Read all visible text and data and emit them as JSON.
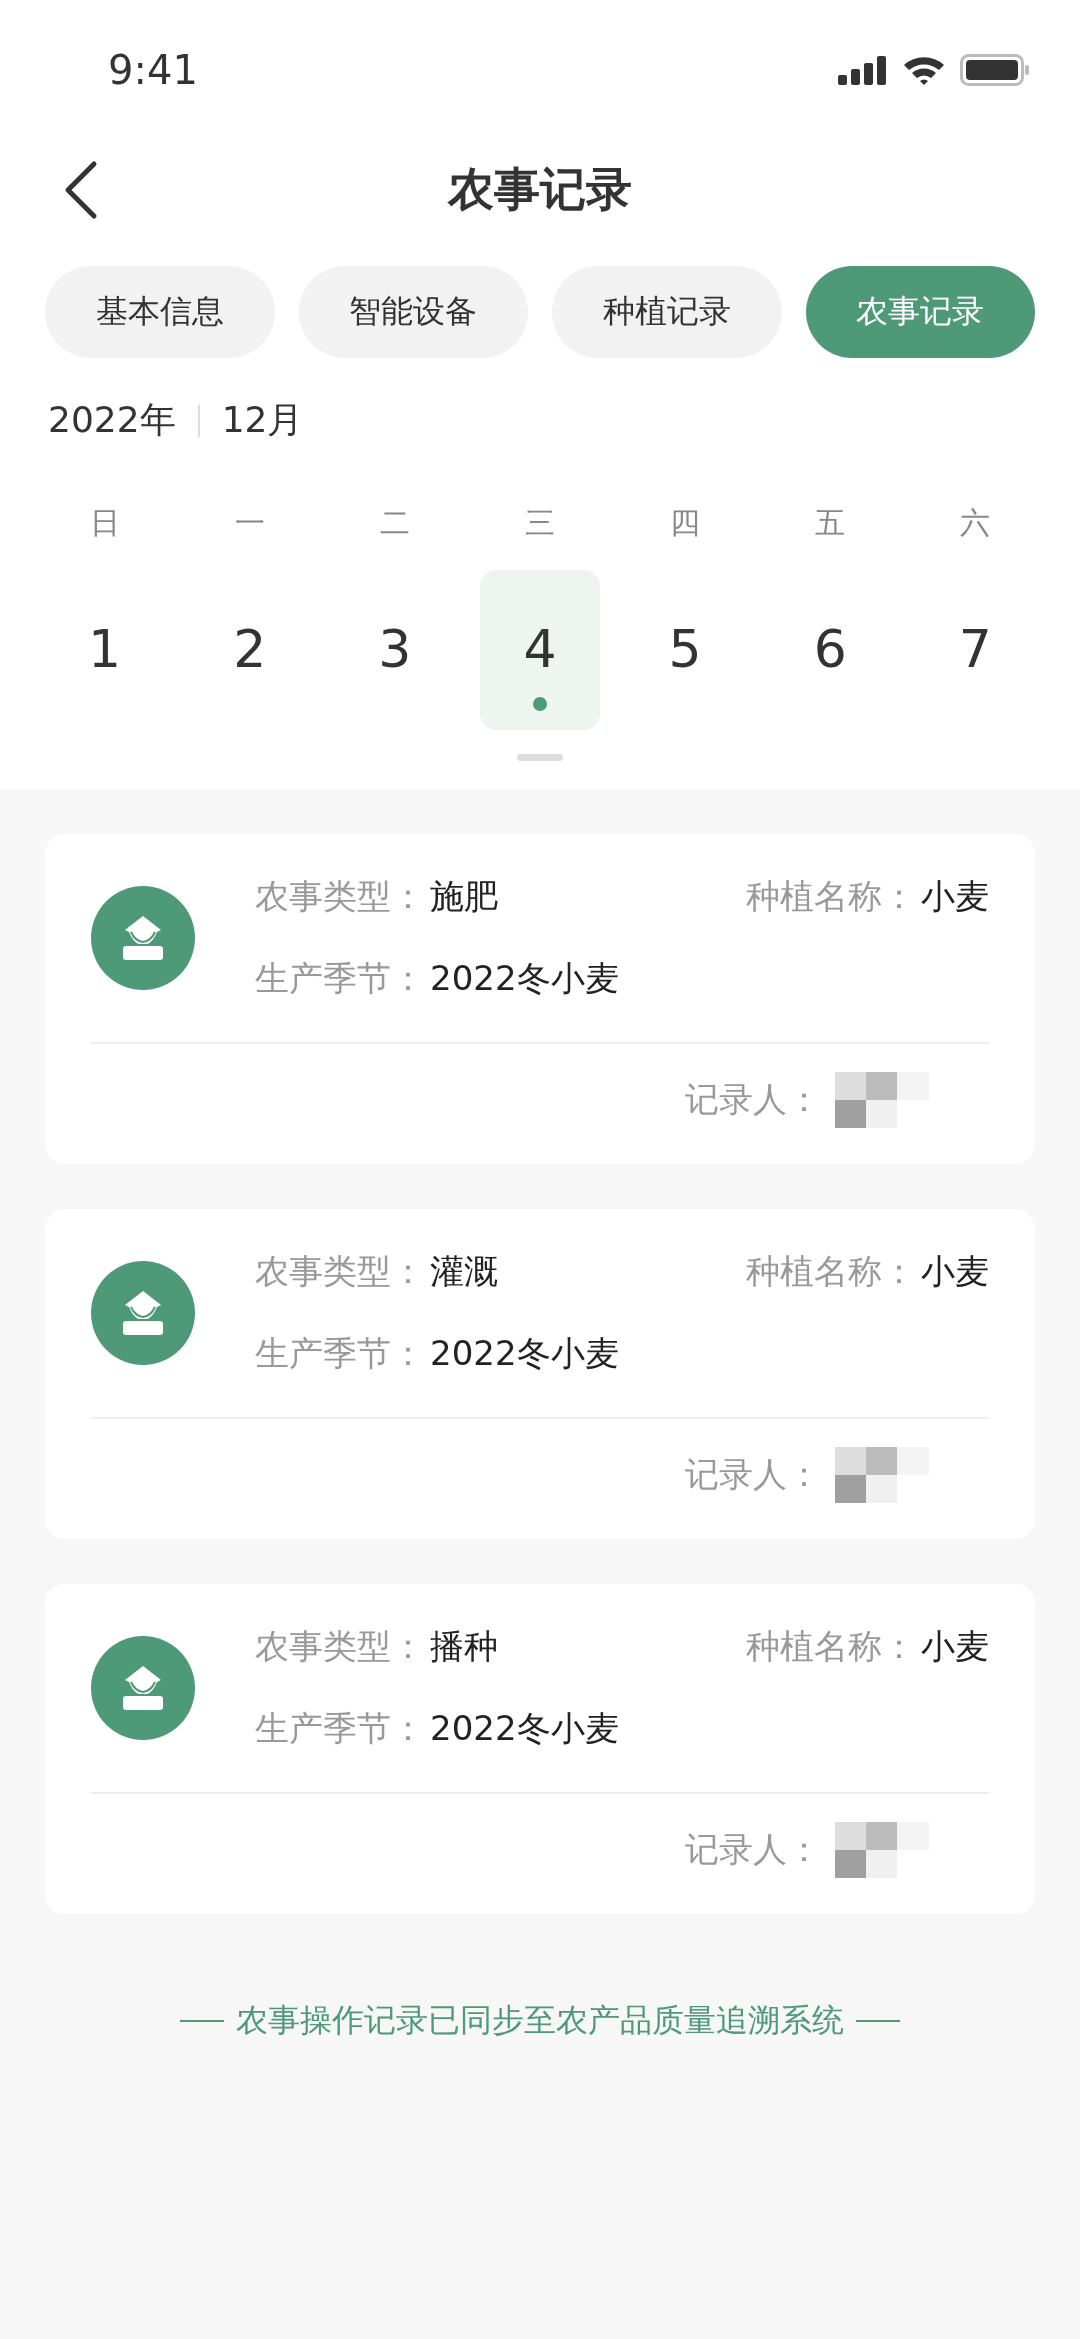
{
  "status_bar": {
    "time": "9:41"
  },
  "header": {
    "title": "农事记录"
  },
  "tabs": [
    {
      "label": "基本信息",
      "selected": false
    },
    {
      "label": "智能设备",
      "selected": false
    },
    {
      "label": "种植记录",
      "selected": false
    },
    {
      "label": "农事记录",
      "selected": true
    }
  ],
  "calendar": {
    "year": "2022年",
    "month": "12月",
    "weekdays": [
      "日",
      "一",
      "二",
      "三",
      "四",
      "五",
      "六"
    ],
    "days": [
      {
        "label": "1",
        "selected": false,
        "has_record": false
      },
      {
        "label": "2",
        "selected": false,
        "has_record": false
      },
      {
        "label": "3",
        "selected": false,
        "has_record": false
      },
      {
        "label": "4",
        "selected": true,
        "has_record": true
      },
      {
        "label": "5",
        "selected": false,
        "has_record": false
      },
      {
        "label": "6",
        "selected": false,
        "has_record": false
      },
      {
        "label": "7",
        "selected": false,
        "has_record": false
      }
    ]
  },
  "records": [
    {
      "type_label": "农事类型：",
      "type": "施肥",
      "crop_label": "种植名称：",
      "crop": "小麦",
      "season_label": "生产季节：",
      "season": "2022冬小麦",
      "recorder_label": "记录人："
    },
    {
      "type_label": "农事类型：",
      "type": "灌溉",
      "crop_label": "种植名称：",
      "crop": "小麦",
      "season_label": "生产季节：",
      "season": "2022冬小麦",
      "recorder_label": "记录人："
    },
    {
      "type_label": "农事类型：",
      "type": "播种",
      "crop_label": "种植名称：",
      "crop": "小麦",
      "season_label": "生产季节：",
      "season": "2022冬小麦",
      "recorder_label": "记录人："
    }
  ],
  "footer": {
    "note": "农事操作记录已同步至农产品质量追溯系统"
  }
}
